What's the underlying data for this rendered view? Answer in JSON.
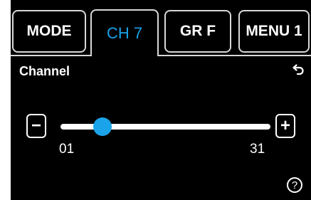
{
  "tabs": [
    {
      "label": "MODE"
    },
    {
      "label": "CH 7",
      "active": true
    },
    {
      "label": "GR F"
    },
    {
      "label": "MENU 1"
    }
  ],
  "page": {
    "title": "Channel"
  },
  "slider": {
    "min_label": "01",
    "max_label": "31",
    "min": 1,
    "max": 31,
    "value": 7,
    "decrement_label": "−",
    "increment_label": "+"
  },
  "help": {
    "label": "?"
  },
  "icons": {
    "back": "back-arrow-icon",
    "help": "help-icon"
  },
  "colors": {
    "background": "#000000",
    "accent": "#1aa3e8",
    "foreground": "#ffffff"
  }
}
